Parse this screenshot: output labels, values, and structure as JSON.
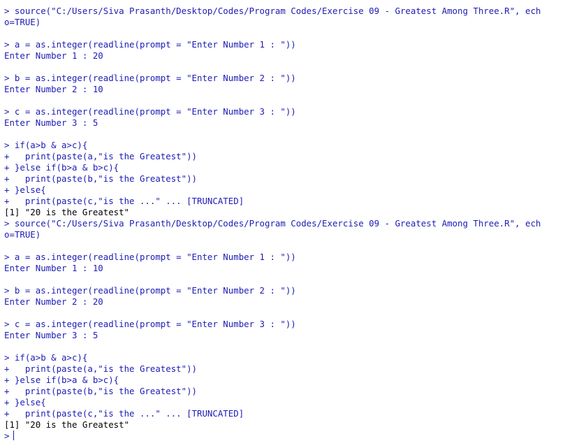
{
  "console": {
    "prompt_symbol": ">",
    "lines": [
      {
        "kind": "cmd",
        "text": "> source(\"C:/Users/Siva Prasanth/Desktop/Codes/Program Codes/Exercise 09 - Greatest Among Three.R\", ech"
      },
      {
        "kind": "cmd",
        "text": "o=TRUE)"
      },
      {
        "kind": "blank",
        "text": ""
      },
      {
        "kind": "cmd",
        "text": "> a = as.integer(readline(prompt = \"Enter Number 1 : \"))"
      },
      {
        "kind": "input-echo",
        "text": "Enter Number 1 : 20"
      },
      {
        "kind": "blank",
        "text": ""
      },
      {
        "kind": "cmd",
        "text": "> b = as.integer(readline(prompt = \"Enter Number 2 : \"))"
      },
      {
        "kind": "input-echo",
        "text": "Enter Number 2 : 10"
      },
      {
        "kind": "blank",
        "text": ""
      },
      {
        "kind": "cmd",
        "text": "> c = as.integer(readline(prompt = \"Enter Number 3 : \"))"
      },
      {
        "kind": "input-echo",
        "text": "Enter Number 3 : 5"
      },
      {
        "kind": "blank",
        "text": ""
      },
      {
        "kind": "cmd",
        "text": "> if(a>b & a>c){"
      },
      {
        "kind": "cmd",
        "text": "+   print(paste(a,\"is the Greatest\"))"
      },
      {
        "kind": "cmd",
        "text": "+ }else if(b>a & b>c){"
      },
      {
        "kind": "cmd",
        "text": "+   print(paste(b,\"is the Greatest\"))"
      },
      {
        "kind": "cmd",
        "text": "+ }else{"
      },
      {
        "kind": "cmd",
        "text": "+   print(paste(c,\"is the ...\" ... [TRUNCATED]"
      },
      {
        "kind": "out",
        "text": "[1] \"20 is the Greatest\""
      },
      {
        "kind": "cmd",
        "text": "> source(\"C:/Users/Siva Prasanth/Desktop/Codes/Program Codes/Exercise 09 - Greatest Among Three.R\", ech"
      },
      {
        "kind": "cmd",
        "text": "o=TRUE)"
      },
      {
        "kind": "blank",
        "text": ""
      },
      {
        "kind": "cmd",
        "text": "> a = as.integer(readline(prompt = \"Enter Number 1 : \"))"
      },
      {
        "kind": "input-echo",
        "text": "Enter Number 1 : 10"
      },
      {
        "kind": "blank",
        "text": ""
      },
      {
        "kind": "cmd",
        "text": "> b = as.integer(readline(prompt = \"Enter Number 2 : \"))"
      },
      {
        "kind": "input-echo",
        "text": "Enter Number 2 : 20"
      },
      {
        "kind": "blank",
        "text": ""
      },
      {
        "kind": "cmd",
        "text": "> c = as.integer(readline(prompt = \"Enter Number 3 : \"))"
      },
      {
        "kind": "input-echo",
        "text": "Enter Number 3 : 5"
      },
      {
        "kind": "blank",
        "text": ""
      },
      {
        "kind": "cmd",
        "text": "> if(a>b & a>c){"
      },
      {
        "kind": "cmd",
        "text": "+   print(paste(a,\"is the Greatest\"))"
      },
      {
        "kind": "cmd",
        "text": "+ }else if(b>a & b>c){"
      },
      {
        "kind": "cmd",
        "text": "+   print(paste(b,\"is the Greatest\"))"
      },
      {
        "kind": "cmd",
        "text": "+ }else{"
      },
      {
        "kind": "cmd",
        "text": "+   print(paste(c,\"is the ...\" ... [TRUNCATED]"
      },
      {
        "kind": "out",
        "text": "[1] \"20 is the Greatest\""
      }
    ]
  },
  "colors": {
    "command": "#1c1cb4",
    "output": "#000000",
    "background": "#ffffff"
  }
}
